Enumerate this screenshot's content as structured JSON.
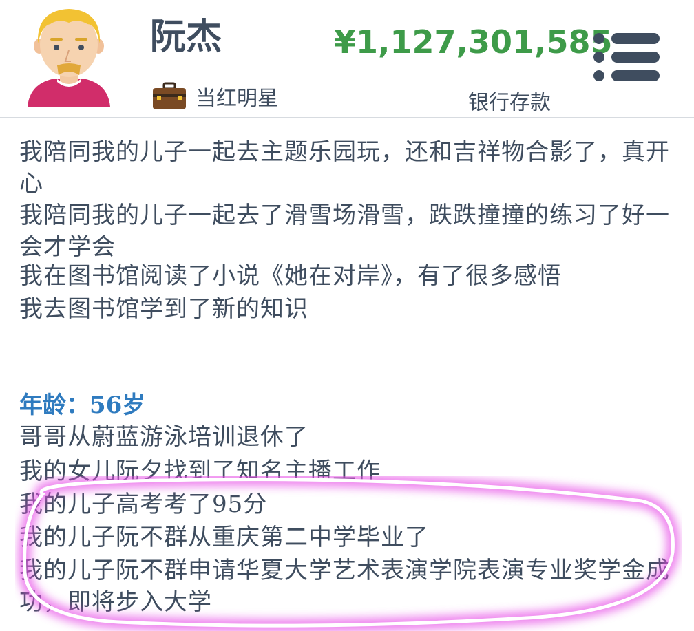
{
  "header": {
    "name": "阮杰",
    "job": "当红明星",
    "money": "¥1,127,301,585",
    "money_label": "银行存款",
    "menu_icon": "menu-icon",
    "job_icon": "briefcase-icon"
  },
  "log": {
    "entries_top": [
      "我陪同我的儿子一起去主题乐园玩，还和吉祥物合影了，真开心",
      "我陪同我的儿子一起去了滑雪场滑雪，跌跌撞撞的练习了好一会才学会",
      "我在图书馆阅读了小说《她在对岸》，有了很多感悟",
      "我去图书馆学到了新的知识"
    ],
    "age_label": "年龄：56岁",
    "entries_bottom": [
      "哥哥从蔚蓝游泳培训退休了",
      "我的女儿阮夕找到了知名主播工作",
      "我的儿子高考考了95分",
      "我的儿子阮不群从重庆第二中学毕业了",
      "我的儿子阮不群申请华夏大学艺术表演学院表演专业奖学金成功，即将步入大学"
    ]
  },
  "colors": {
    "text": "#3f4d5f",
    "money": "#3e9b49",
    "age_label": "#2f7bbf",
    "highlight": "#e64ee6"
  }
}
